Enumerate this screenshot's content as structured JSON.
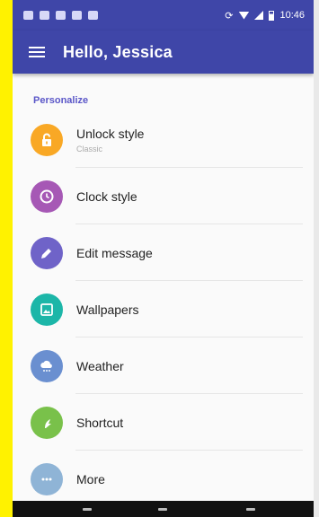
{
  "status_bar": {
    "time": "10:46"
  },
  "app_bar": {
    "title": "Hello, Jessica"
  },
  "section": {
    "label": "Personalize"
  },
  "items": [
    {
      "label": "Unlock style",
      "subtitle": "Classic",
      "icon": "lock-open-icon",
      "color": "#f9a825"
    },
    {
      "label": "Clock style",
      "icon": "clock-icon",
      "color": "#a658b5"
    },
    {
      "label": "Edit message",
      "icon": "pencil-icon",
      "color": "#6f63c8"
    },
    {
      "label": "Wallpapers",
      "icon": "wallpaper-icon",
      "color": "#1cb6a8"
    },
    {
      "label": "Weather",
      "icon": "weather-icon",
      "color": "#6a8fd0"
    },
    {
      "label": "Shortcut",
      "icon": "shortcut-icon",
      "color": "#79c14a"
    },
    {
      "label": "More",
      "icon": "more-icon",
      "color": "#8fb4d6"
    }
  ]
}
